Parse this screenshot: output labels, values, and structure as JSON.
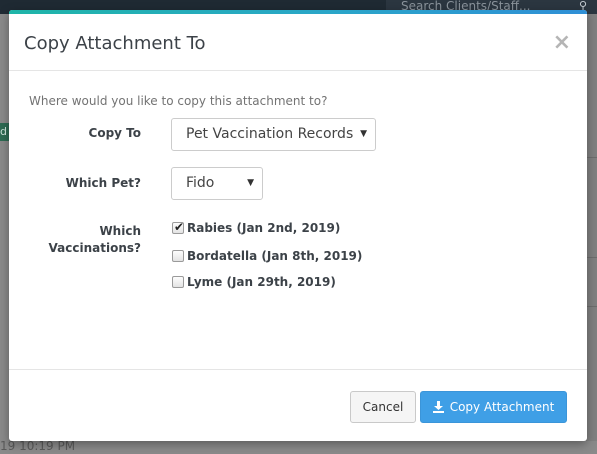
{
  "background": {
    "search_placeholder": "Search Clients/Staff...",
    "search_icon": "search-icon",
    "side_tab_text": "d",
    "bottom_timestamp": "19 10:19 PM"
  },
  "modal": {
    "title": "Copy Attachment To",
    "close_icon": "×",
    "prompt": "Where would you like to copy this attachment to?",
    "accent_colors": [
      "#1fb5a8",
      "#2f8fd6"
    ],
    "fields": {
      "copy_to": {
        "label": "Copy To",
        "value": "Pet Vaccination Records"
      },
      "which_pet": {
        "label": "Which Pet?",
        "value": "Fido"
      },
      "which_vaccinations": {
        "label_line1": "Which",
        "label_line2": "Vaccinations?",
        "options": [
          {
            "label": "Rabies (Jan 2nd, 2019)",
            "checked": true
          },
          {
            "label": "Bordatella (Jan 8th, 2019)",
            "checked": false
          },
          {
            "label": "Lyme (Jan 29th, 2019)",
            "checked": false
          }
        ]
      }
    },
    "footer": {
      "cancel_label": "Cancel",
      "primary_label": "Copy Attachment",
      "primary_icon": "download-icon",
      "primary_color": "#3f9fe6"
    }
  }
}
